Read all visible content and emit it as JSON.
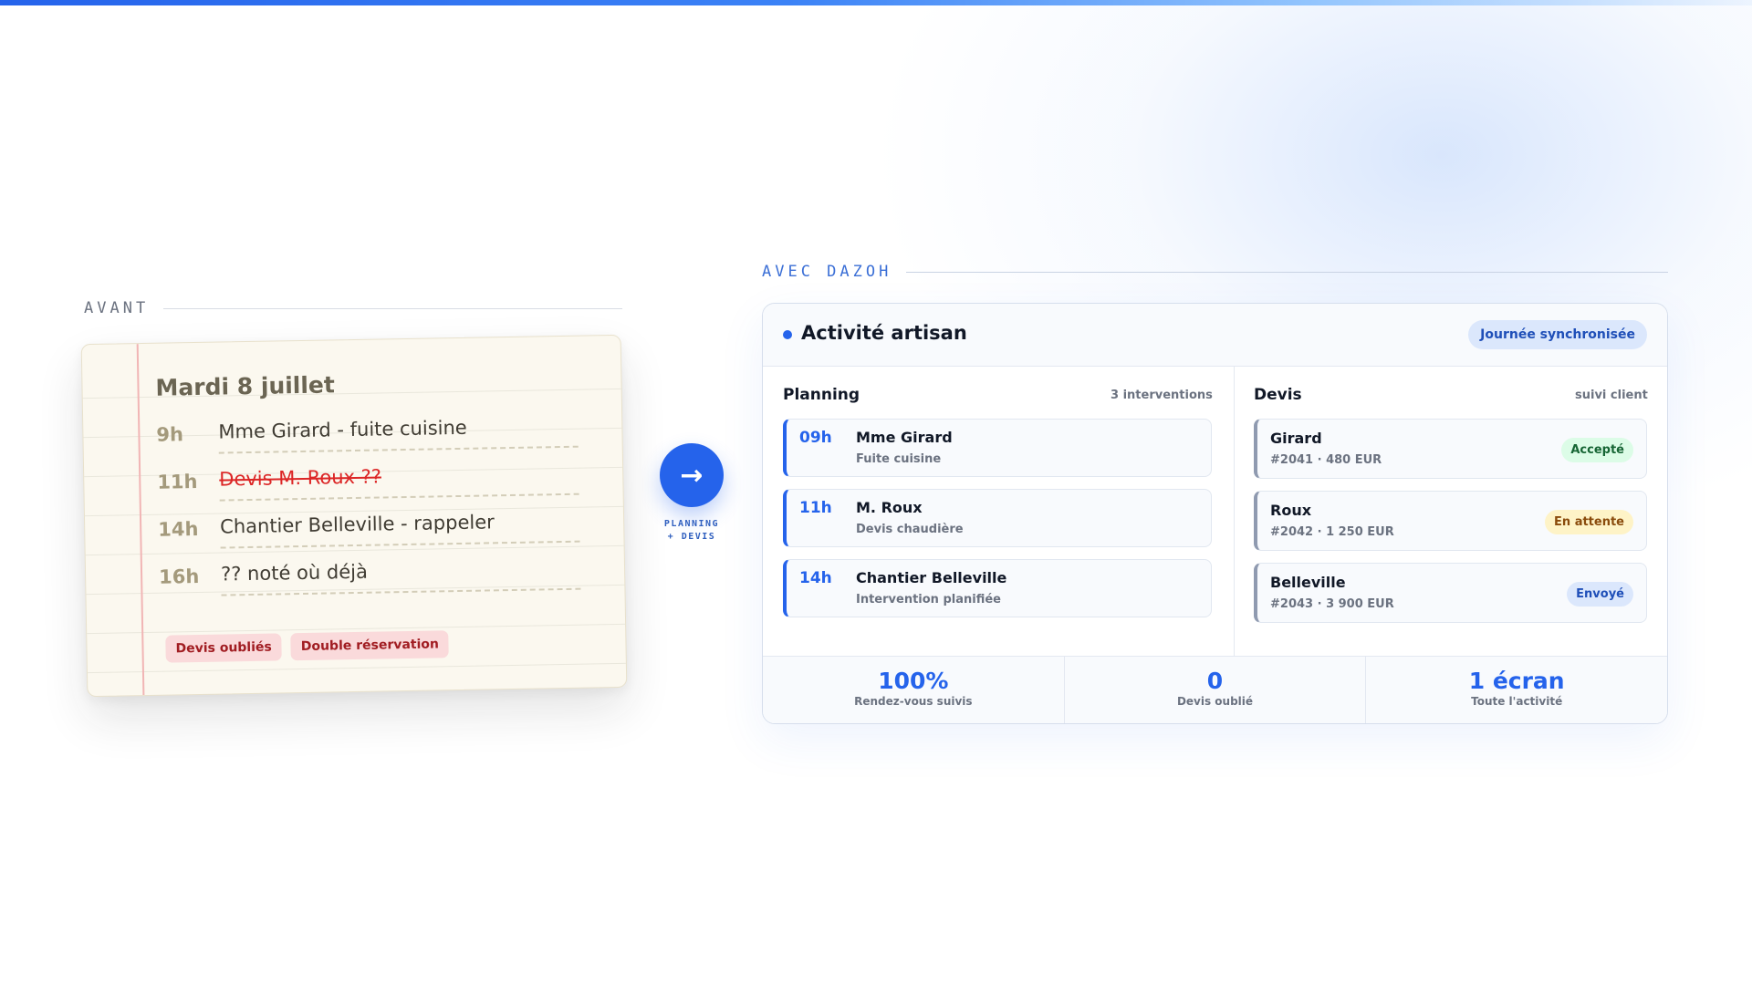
{
  "colors": {
    "accent": "#2563eb",
    "strike_red": "#dc2626",
    "tag_bg": "#fadadb",
    "accepted": "#166534",
    "pending": "#8a4b0c"
  },
  "before": {
    "label": "AVANT",
    "date": "Mardi 8 juillet",
    "entries": [
      {
        "hour": "9h",
        "text": "Mme Girard - fuite cuisine",
        "struck": false
      },
      {
        "hour": "11h",
        "text": "Devis M. Roux ??",
        "struck": true
      },
      {
        "hour": "14h",
        "text": "Chantier Belleville - rappeler",
        "struck": false
      },
      {
        "hour": "16h",
        "text": "?? noté où déjà",
        "struck": false
      }
    ],
    "tags": [
      "Devis oubliés",
      "Double réservation"
    ]
  },
  "transition": {
    "icon": "arrow-right-icon",
    "glyph": "→",
    "caption_line1": "PLANNING",
    "caption_line2": "+ DEVIS"
  },
  "after": {
    "label": "AVEC DAZOH",
    "panel_title": "Activité artisan",
    "sync_badge": "Journée synchronisée",
    "planning": {
      "title": "Planning",
      "meta": "3 interventions",
      "items": [
        {
          "hour": "09h",
          "name": "Mme Girard",
          "sub": "Fuite cuisine"
        },
        {
          "hour": "11h",
          "name": "M. Roux",
          "sub": "Devis chaudière"
        },
        {
          "hour": "14h",
          "name": "Chantier Belleville",
          "sub": "Intervention planifiée"
        }
      ]
    },
    "devis": {
      "title": "Devis",
      "meta": "suivi client",
      "items": [
        {
          "name": "Girard",
          "sub": "#2041 · 480 EUR",
          "status": "Accepté"
        },
        {
          "name": "Roux",
          "sub": "#2042 · 1 250 EUR",
          "status": "En attente"
        },
        {
          "name": "Belleville",
          "sub": "#2043 · 3 900 EUR",
          "status": "Envoyé"
        }
      ]
    },
    "stats": [
      {
        "value": "100%",
        "label": "Rendez-vous suivis"
      },
      {
        "value": "0",
        "label": "Devis oublié"
      },
      {
        "value": "1 écran",
        "label": "Toute l'activité"
      }
    ]
  }
}
